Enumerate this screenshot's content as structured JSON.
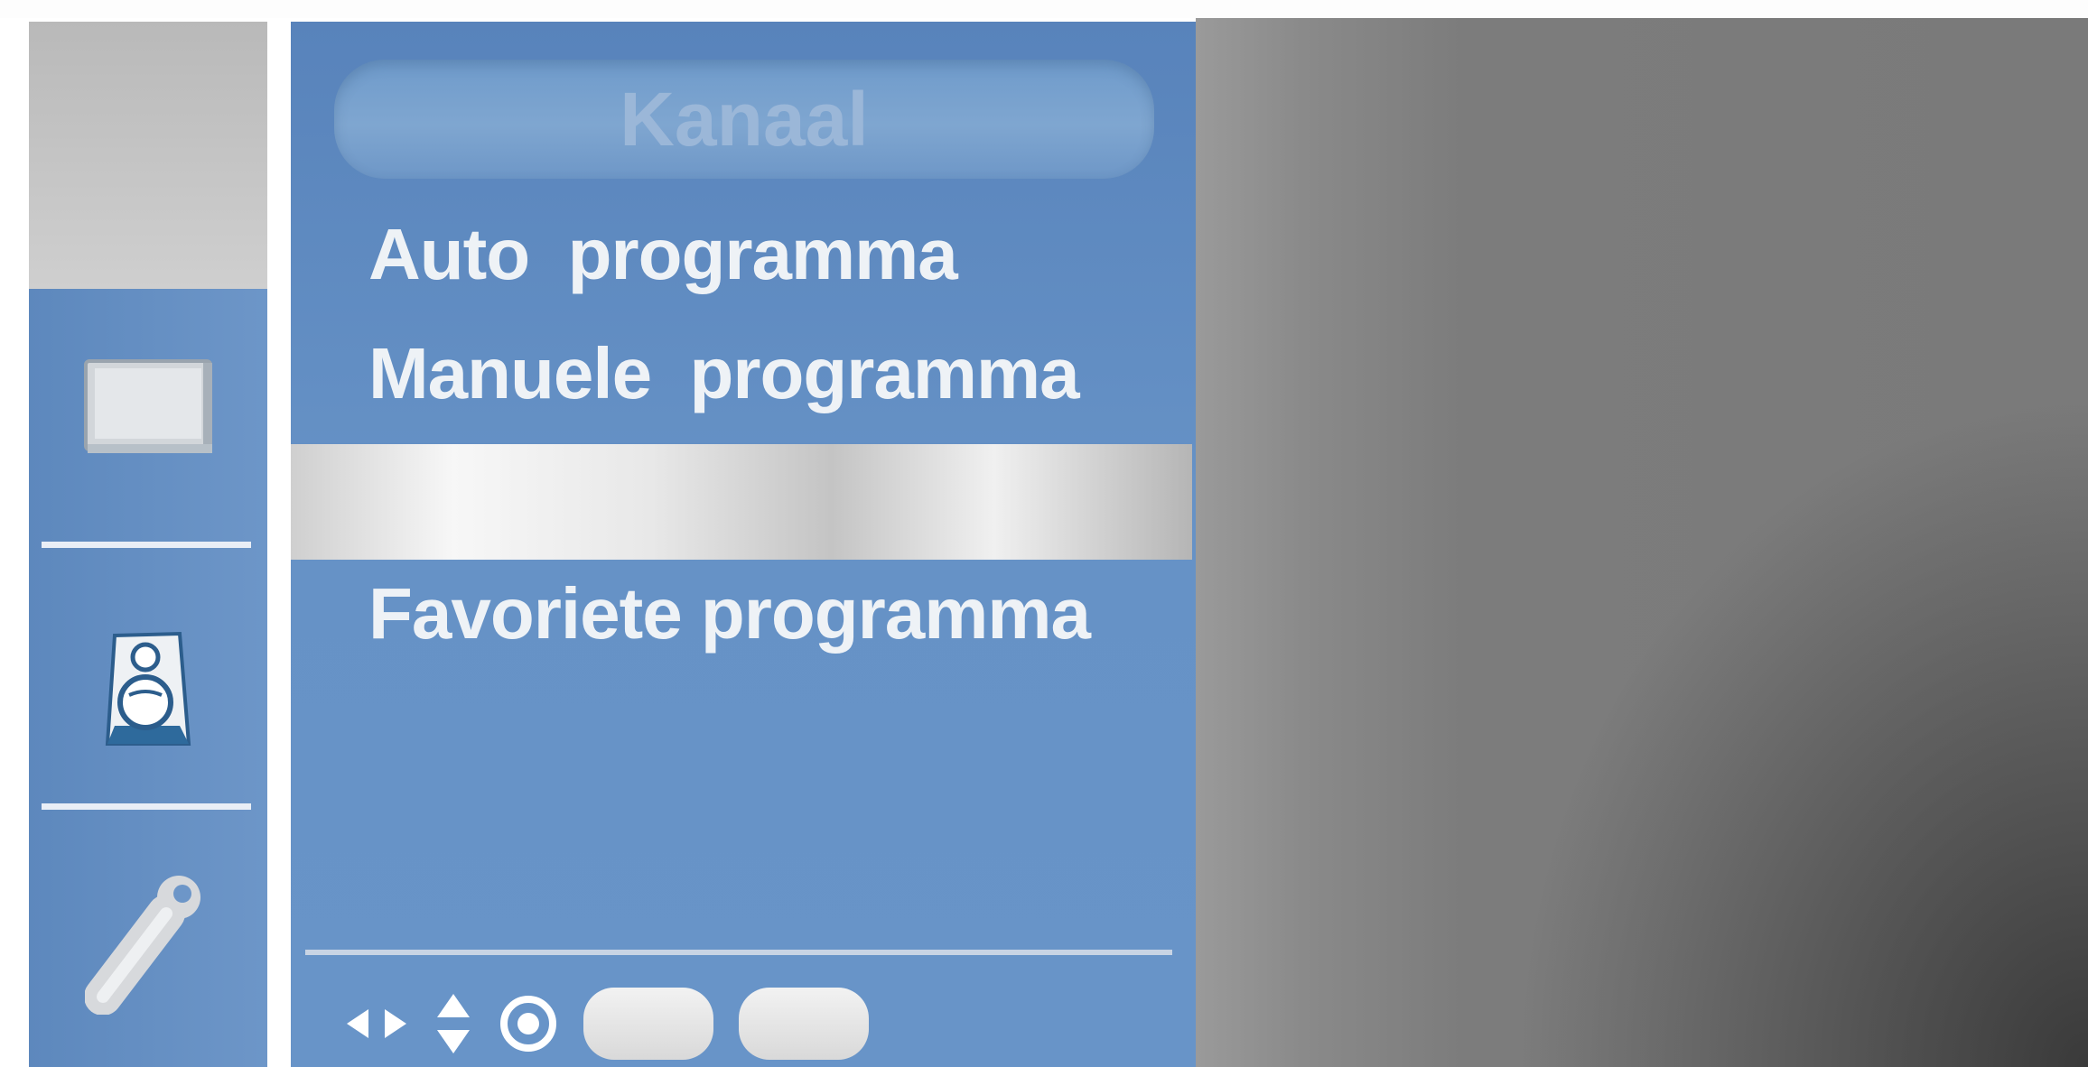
{
  "menu": {
    "title": "Kanaal",
    "items": [
      {
        "label": "Auto  programma"
      },
      {
        "label": "Manuele  programma"
      },
      {
        "label": ""
      },
      {
        "label": "Favoriete programma"
      }
    ]
  },
  "sidebar": {
    "icons": [
      "picture-icon",
      "audio-speaker-icon",
      "setup-wrench-icon"
    ]
  },
  "hints": [
    "left-right-arrows-icon",
    "up-down-arrows-icon",
    "ok-button-icon",
    "button-key-1",
    "button-key-2"
  ]
}
